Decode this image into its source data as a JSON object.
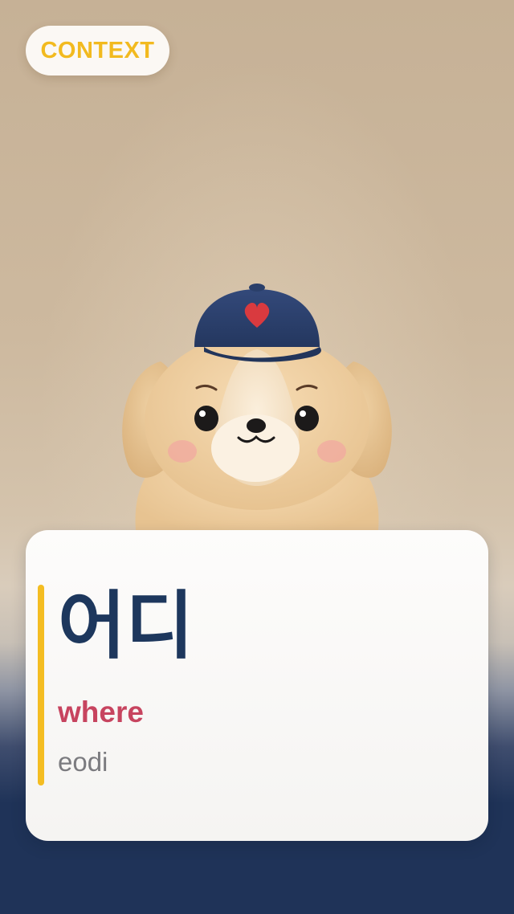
{
  "context_badge": {
    "label": "CONTEXT"
  },
  "mascot": {
    "description_icon": "puppy-mascot-with-heart-cap"
  },
  "flashcard": {
    "word": "어디",
    "meaning": "where",
    "romanization": "eodi"
  },
  "colors": {
    "accent": "#f4bd22",
    "word": "#1d375d",
    "meaning": "#c7445f",
    "romanization": "#7b7b7f",
    "background_bottom": "#1f3358"
  }
}
